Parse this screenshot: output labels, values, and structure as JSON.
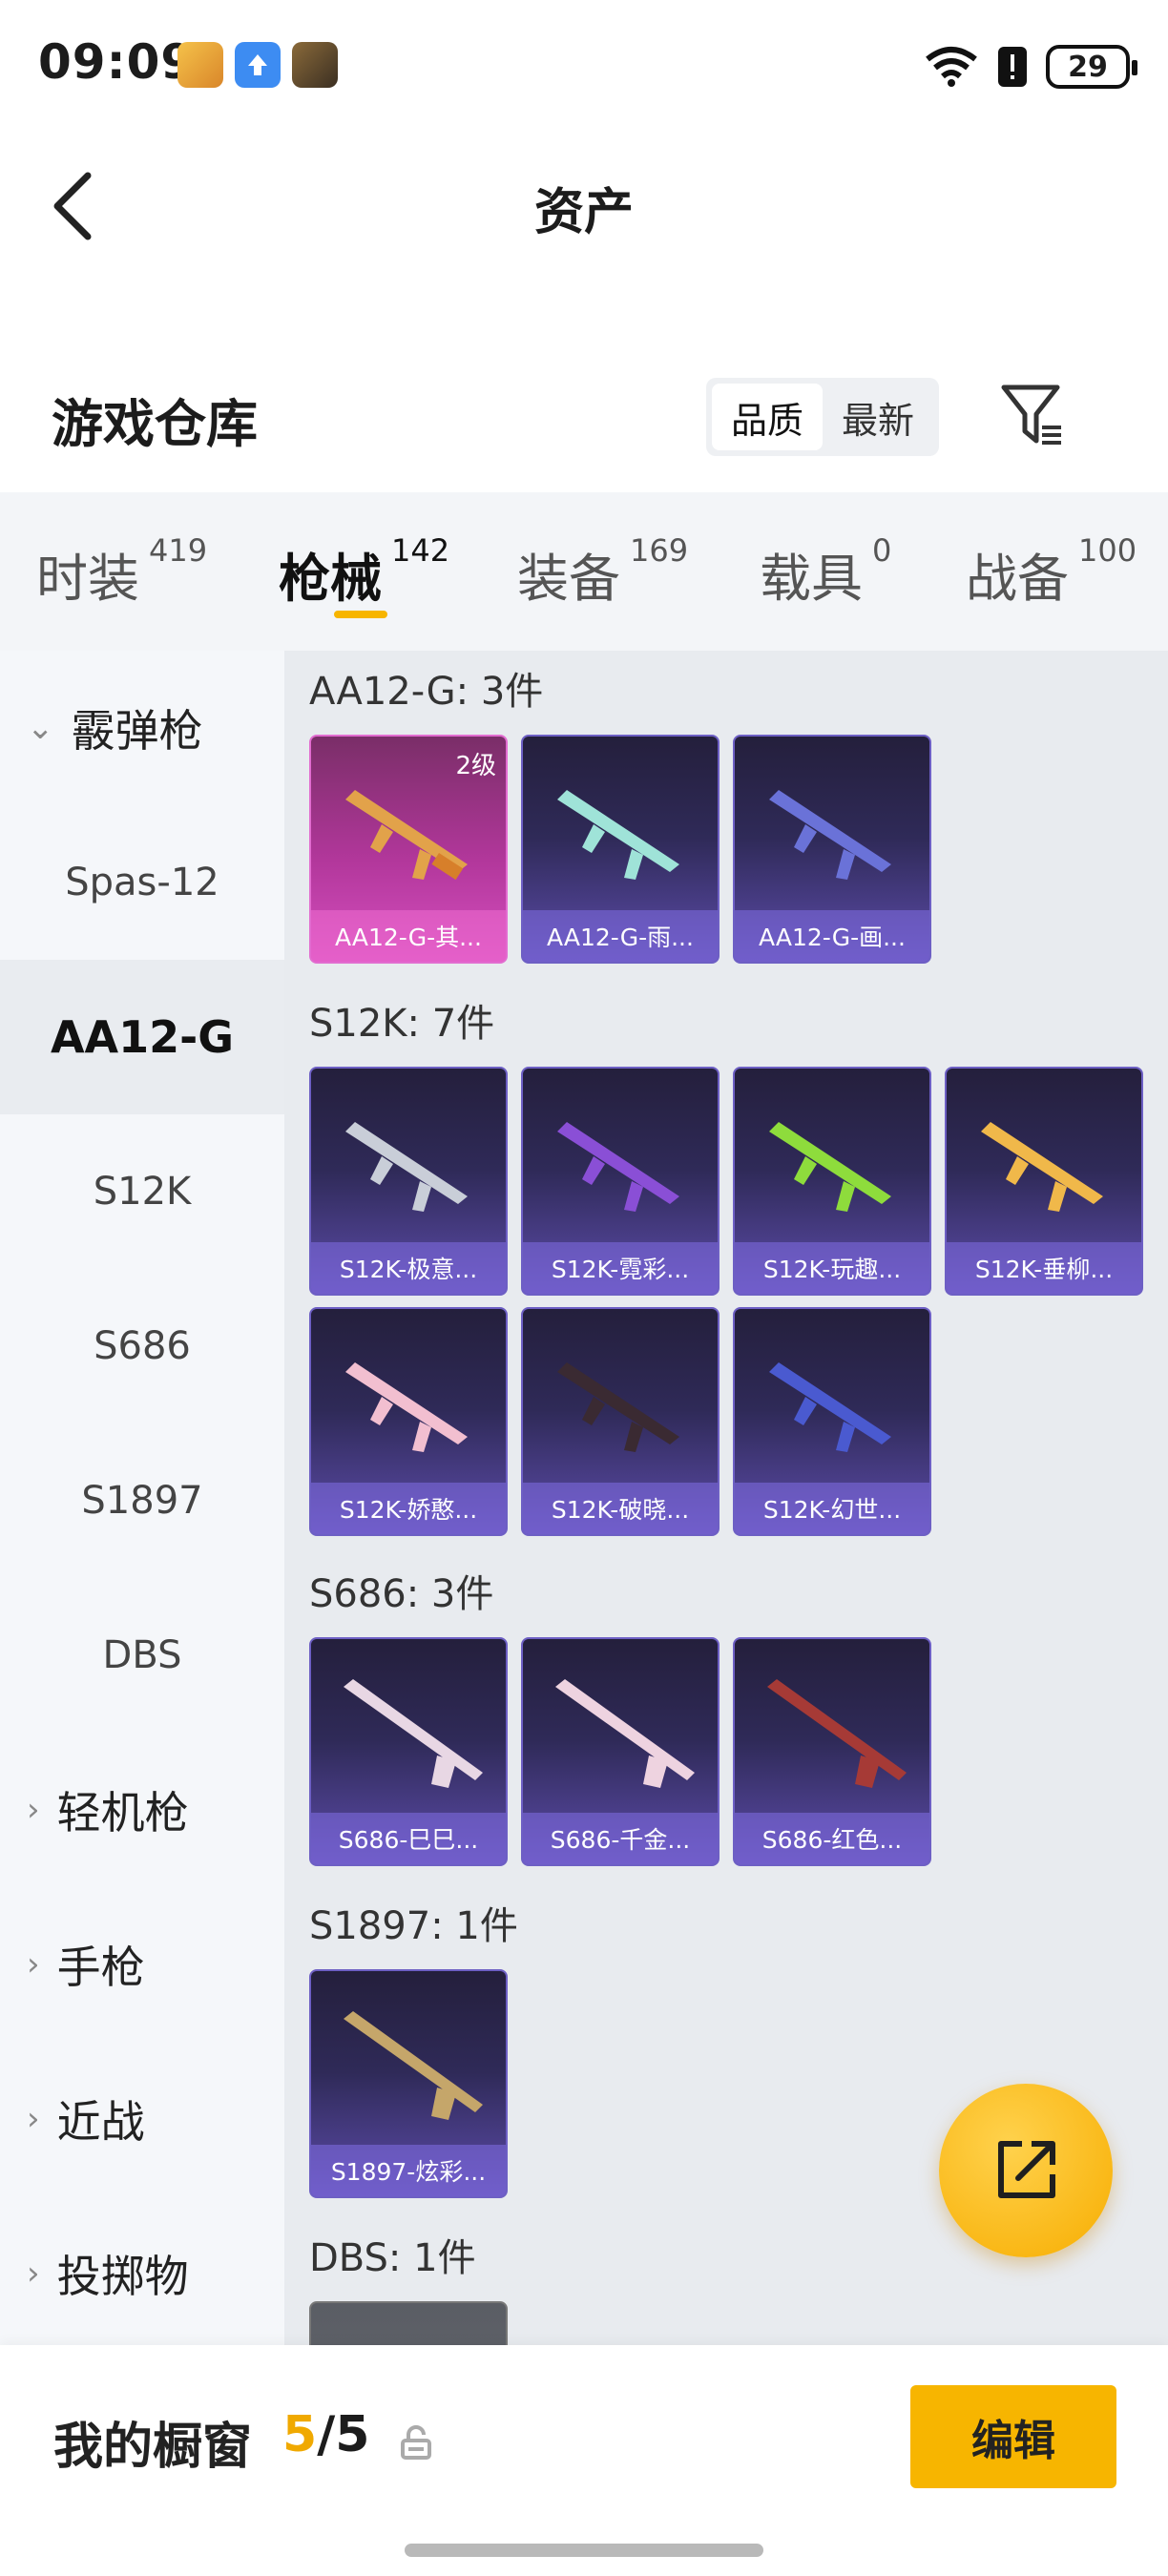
{
  "status_bar": {
    "time": "09:09",
    "battery": "29"
  },
  "header": {
    "title": "资产"
  },
  "warehouse": {
    "title": "游戏仓库",
    "sort_options": [
      "品质",
      "最新"
    ],
    "active_sort": "品质"
  },
  "tabs": [
    {
      "label": "时装",
      "count": "419"
    },
    {
      "label": "枪械",
      "count": "142"
    },
    {
      "label": "装备",
      "count": "169"
    },
    {
      "label": "载具",
      "count": "0"
    },
    {
      "label": "战备",
      "count": "100"
    }
  ],
  "active_tab": "枪械",
  "sidebar": {
    "items": [
      {
        "label": "霰弹枪",
        "type": "group",
        "expanded": true
      },
      {
        "label": "Spas-12",
        "type": "item"
      },
      {
        "label": "AA12-G",
        "type": "item",
        "active": true
      },
      {
        "label": "S12K",
        "type": "item"
      },
      {
        "label": "S686",
        "type": "item"
      },
      {
        "label": "S1897",
        "type": "item"
      },
      {
        "label": "DBS",
        "type": "item"
      },
      {
        "label": "轻机枪",
        "type": "group"
      },
      {
        "label": "手枪",
        "type": "group"
      },
      {
        "label": "近战",
        "type": "group"
      },
      {
        "label": "投掷物",
        "type": "group"
      }
    ]
  },
  "sections": [
    {
      "title": "AA12-G: 3件",
      "items": [
        {
          "name": "AA12-G-其...",
          "badge": "2级",
          "rarity": "pink"
        },
        {
          "name": "AA12-G-雨...",
          "rarity": "purple"
        },
        {
          "name": "AA12-G-画...",
          "rarity": "purple"
        }
      ]
    },
    {
      "title": "S12K: 7件",
      "items": [
        {
          "name": "S12K-极意...",
          "rarity": "purple"
        },
        {
          "name": "S12K-霓彩...",
          "rarity": "purple"
        },
        {
          "name": "S12K-玩趣...",
          "rarity": "purple"
        },
        {
          "name": "S12K-垂柳...",
          "rarity": "purple"
        },
        {
          "name": "S12K-娇憨...",
          "rarity": "purple"
        },
        {
          "name": "S12K-破晓...",
          "rarity": "purple"
        },
        {
          "name": "S12K-幻世...",
          "rarity": "purple"
        }
      ]
    },
    {
      "title": "S686: 3件",
      "items": [
        {
          "name": "S686-巳巳...",
          "rarity": "purple"
        },
        {
          "name": "S686-千金...",
          "rarity": "purple"
        },
        {
          "name": "S686-红色...",
          "rarity": "purple"
        }
      ]
    },
    {
      "title": "S1897: 1件",
      "items": [
        {
          "name": "S1897-炫彩...",
          "rarity": "purple"
        }
      ]
    },
    {
      "title": "DBS: 1件",
      "items": [
        {
          "name": "",
          "rarity": "gray"
        }
      ]
    }
  ],
  "showcase": {
    "label": "我的橱窗",
    "current": "5",
    "total": "5",
    "edit_label": "编辑"
  },
  "colors": {
    "accent": "#f7b500",
    "purple_card": "#5d4cab",
    "pink_card": "#d64fbf"
  },
  "icons": [
    "back-arrow-icon",
    "filter-icon",
    "share-icon",
    "lock-icon",
    "wifi-icon",
    "battery-icon",
    "chevron-down-icon",
    "chevron-right-icon"
  ]
}
